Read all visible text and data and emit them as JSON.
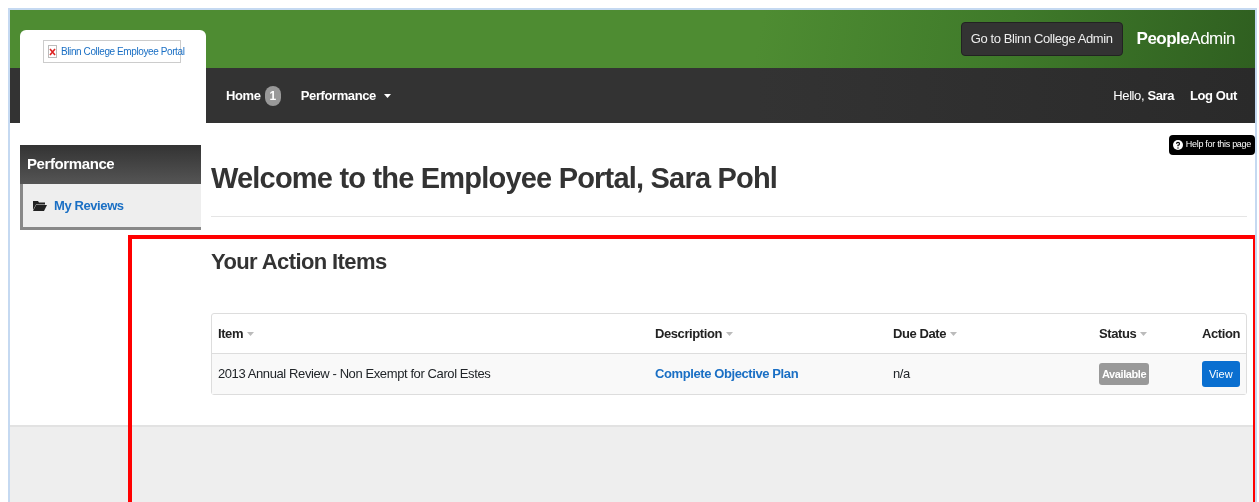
{
  "logo": {
    "alt_text": "Blinn College  Employee Portal"
  },
  "header": {
    "admin_button": "Go to Blinn College Admin",
    "brand_bold": "People",
    "brand_rest": "Admin"
  },
  "nav": {
    "items": [
      {
        "label": "Home",
        "badge": "1",
        "kind": "badge"
      },
      {
        "label": "Performance",
        "kind": "dropdown"
      }
    ],
    "greeting": "Hello,",
    "user": "Sara",
    "logout": "Log Out"
  },
  "sidebar": {
    "title": "Performance",
    "items": [
      {
        "label": "My Reviews"
      }
    ]
  },
  "help_button": "Help for this page",
  "page_title": "Welcome to the Employee Portal, Sara Pohl",
  "section_title": "Your Action Items",
  "table": {
    "columns": [
      {
        "label": "Item",
        "sortable": true
      },
      {
        "label": "Description",
        "sortable": true
      },
      {
        "label": "Due Date",
        "sortable": true
      },
      {
        "label": "Status",
        "sortable": true
      },
      {
        "label": "Action",
        "sortable": false
      }
    ],
    "rows": [
      {
        "item": "2013 Annual Review - Non Exempt for Carol Estes",
        "description": "Complete Objective Plan",
        "due_date": "n/a",
        "status": "Available",
        "action": "View"
      }
    ]
  },
  "annotation": {
    "kind": "rectangle",
    "color": "#ff0000"
  }
}
